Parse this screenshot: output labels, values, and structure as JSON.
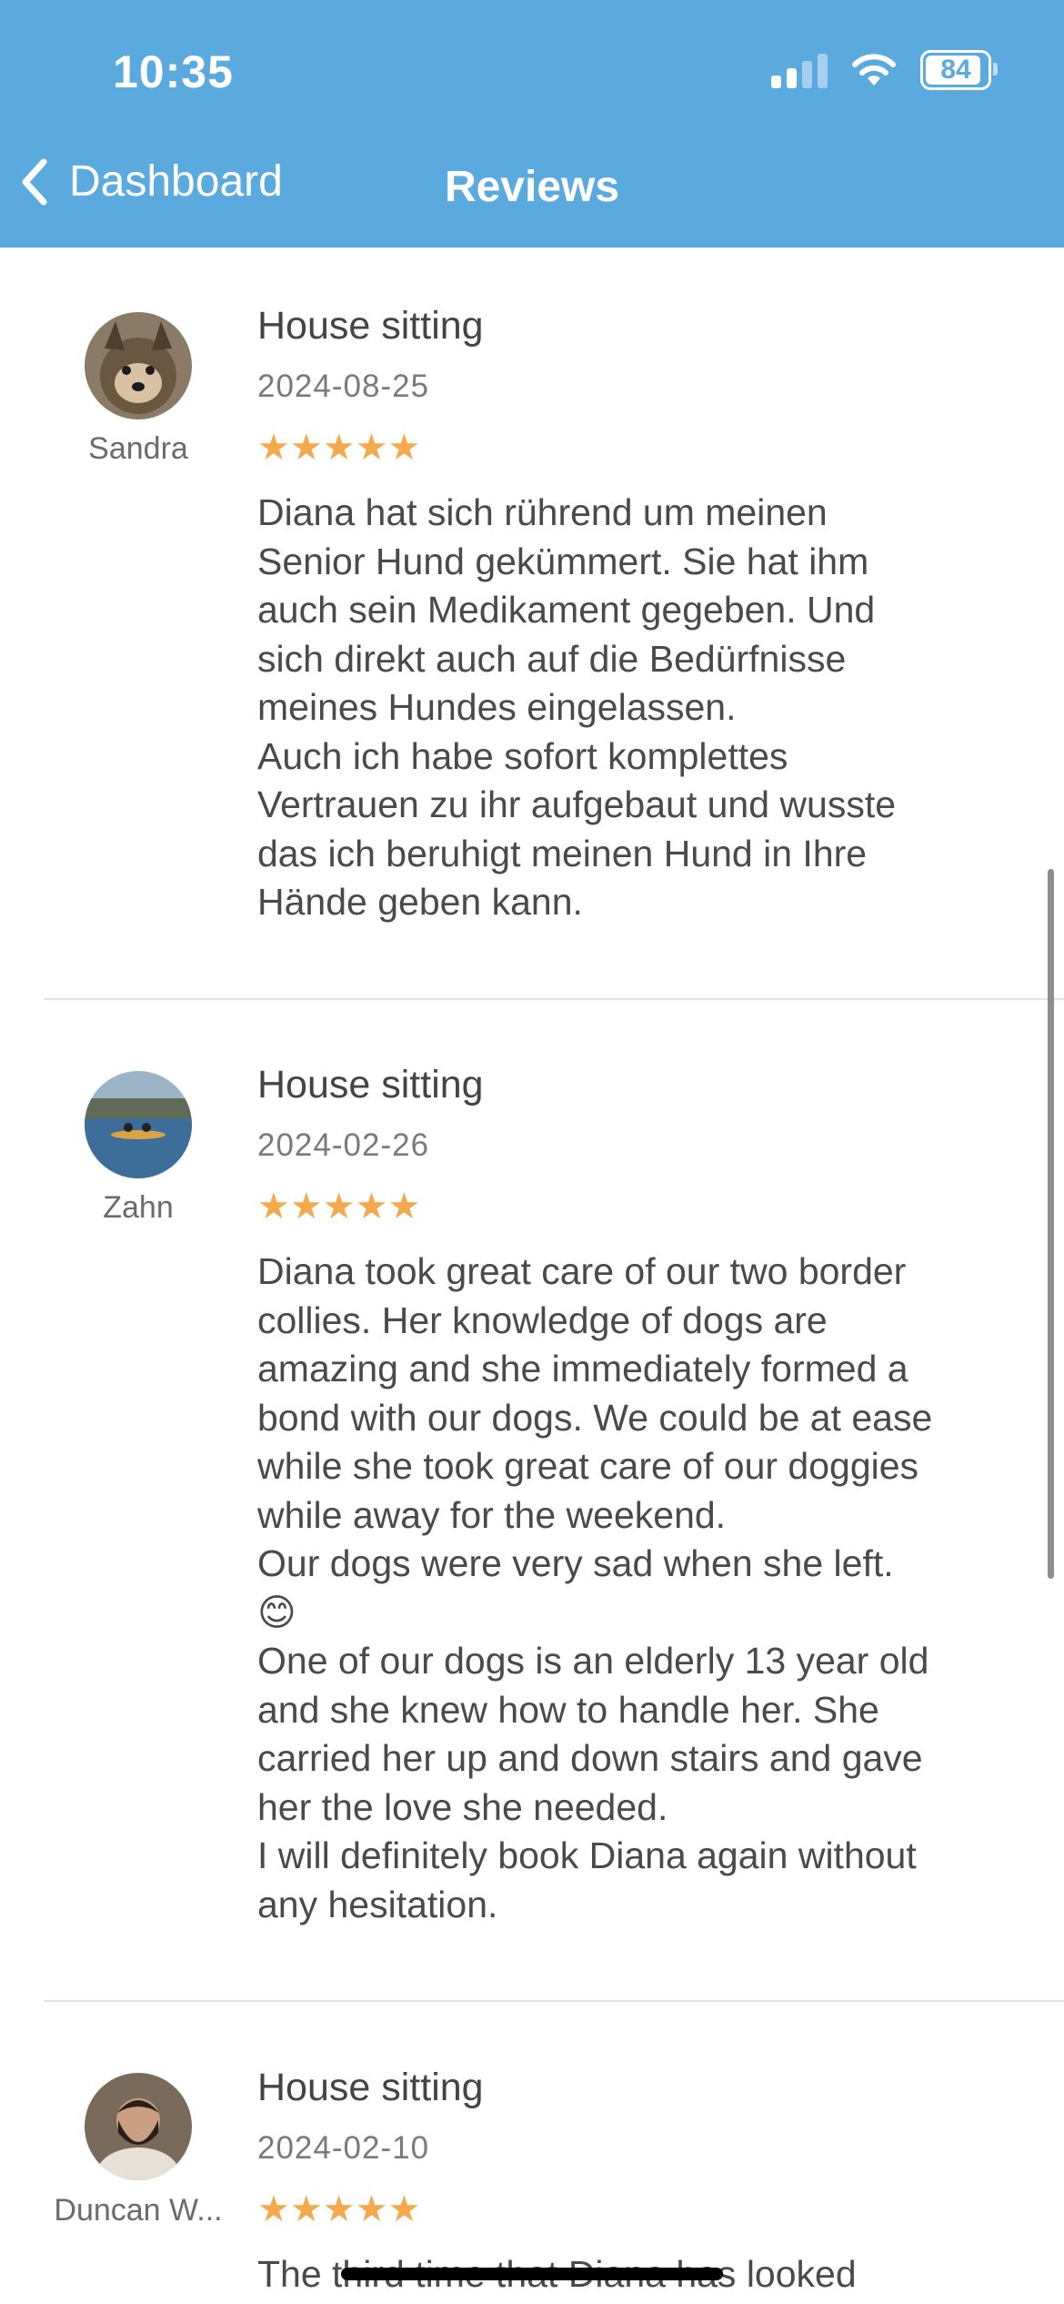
{
  "colors": {
    "accent": "#5aaae0",
    "star": "#f5a94c"
  },
  "status_bar": {
    "time": "10:35",
    "battery": "84"
  },
  "nav": {
    "back_label": "Dashboard",
    "title": "Reviews"
  },
  "reviews": [
    {
      "reviewer": "Sandra",
      "service": "House sitting",
      "date": "2024-08-25",
      "rating": 5,
      "stars": "★★★★★",
      "text": "Diana hat sich rührend um meinen\nSenior Hund gekümmert. Sie hat ihm\nauch sein Medikament gegeben. Und\nsich direkt auch auf die Bedürfnisse\nmeines Hundes eingelassen.\nAuch ich habe sofort komplettes\nVertrauen zu ihr aufgebaut und wusste\ndas ich beruhigt meinen Hund in Ihre\nHände geben kann."
    },
    {
      "reviewer": "Zahn",
      "service": "House sitting",
      "date": "2024-02-26",
      "rating": 5,
      "stars": "★★★★★",
      "text": "Diana took great care of our two border\ncollies. Her knowledge of dogs are\namazing and she immediately formed a\nbond with our dogs. We could be at ease\nwhile she took great care of our doggies\nwhile away for the weekend.\nOur dogs were very sad when she left.\n😊\nOne of our dogs is an elderly 13 year old\nand she knew how to handle her. She\ncarried her up and down stairs and gave\nher the love she needed.\nI will definitely book Diana again without\nany hesitation."
    },
    {
      "reviewer": "Duncan W...",
      "service": "House sitting",
      "date": "2024-02-10",
      "rating": 5,
      "stars": "★★★★★",
      "text": "The third time that Diana has looked"
    }
  ]
}
